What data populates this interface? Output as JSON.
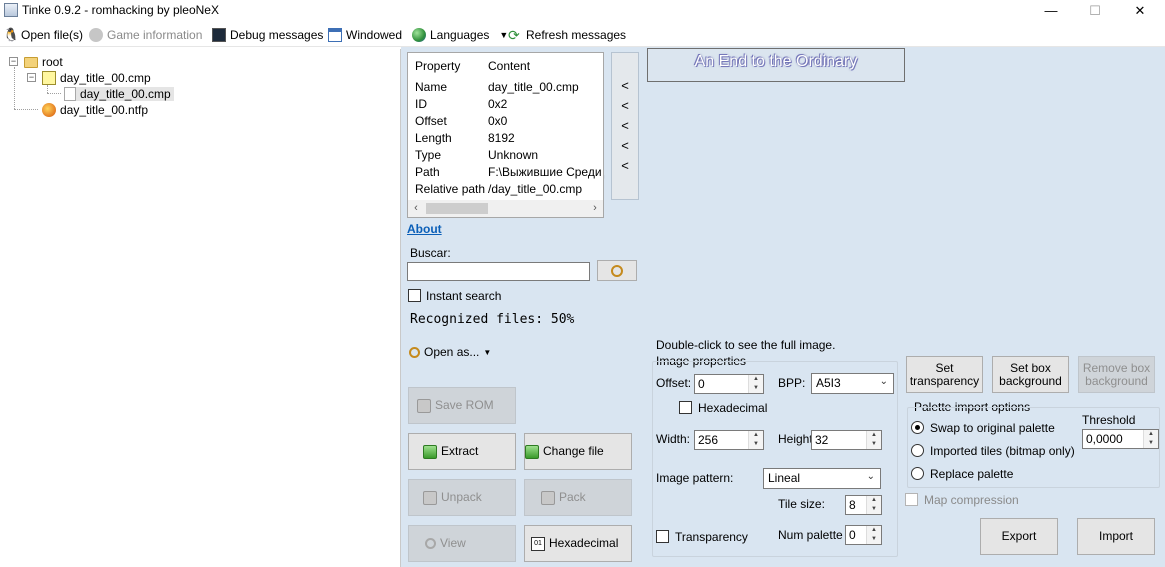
{
  "window": {
    "title": "Tinke 0.9.2 - romhacking by pleoNeX",
    "minimize": "—",
    "maximize": "☐",
    "close": "✕"
  },
  "toolbar": {
    "open_files": "Open file(s)",
    "game_information": "Game information",
    "debug_messages": "Debug messages",
    "windowed": "Windowed",
    "languages": "Languages",
    "refresh_messages": "Refresh messages"
  },
  "tree": {
    "root": "root",
    "cmp_file": "day_title_00.cmp",
    "cmp_child": "day_title_00.cmp",
    "ntfp_file": "day_title_00.ntfp"
  },
  "properties": {
    "header_property": "Property",
    "header_content": "Content",
    "rows": [
      {
        "k": "Name",
        "v": "day_title_00.cmp"
      },
      {
        "k": "ID",
        "v": "0x2"
      },
      {
        "k": "Offset",
        "v": "0x0"
      },
      {
        "k": "Length",
        "v": "8192"
      },
      {
        "k": "Type",
        "v": "Unknown"
      },
      {
        "k": "Path",
        "v": "F:\\Выжившие Среди Д"
      },
      {
        "k": "Relative path",
        "v": "/day_title_00.cmp"
      }
    ]
  },
  "arrows": [
    "<",
    "<",
    "<",
    "<",
    "<"
  ],
  "left_panel": {
    "about": "About",
    "search_label": "Buscar:",
    "search_value": "",
    "instant_search": "Instant search",
    "recognized": "Recognized files: 50%",
    "open_as": "Open as...",
    "save_rom": "Save ROM",
    "extract": "Extract",
    "change_file": "Change file",
    "unpack": "Unpack",
    "pack": "Pack",
    "view": "View",
    "hexadecimal": "Hexadecimal"
  },
  "image_preview": {
    "caption": "An End to the Ordinary"
  },
  "image_props": {
    "hint": "Double-click to see the full image.",
    "group": "Image properties",
    "offset_label": "Offset:",
    "offset_value": "0",
    "bpp_label": "BPP:",
    "bpp_value": "A5I3",
    "hex_label": "Hexadecimal",
    "width_label": "Width:",
    "width_value": "256",
    "height_label": "Height:",
    "height_value": "32",
    "pattern_label": "Image pattern:",
    "pattern_value": "Lineal",
    "tile_size_label": "Tile size:",
    "tile_size_value": "8",
    "transparency_label": "Transparency",
    "num_palette_label": "Num palette",
    "num_palette_value": "0"
  },
  "palette": {
    "set_transparency": "Set transparency",
    "set_box_background": "Set box background",
    "remove_box_background": "Remove box background",
    "group": "Palette import options",
    "threshold_label": "Threshold",
    "threshold_value": "0,0000",
    "swap": "Swap to original palette",
    "imported_tiles": "Imported tiles (bitmap only)",
    "replace": "Replace palette",
    "map_compression": "Map compression",
    "export": "Export",
    "import": "Import"
  }
}
